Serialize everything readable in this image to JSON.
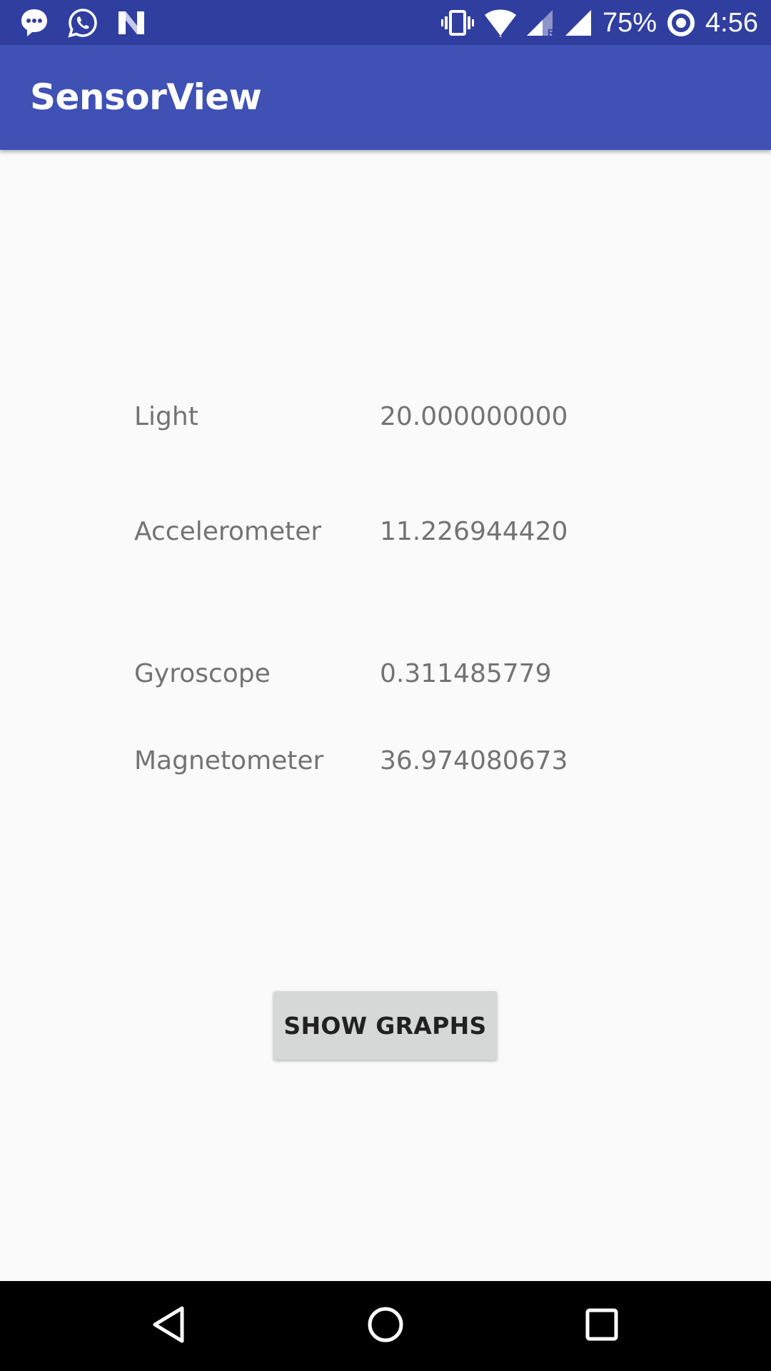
{
  "status_bar": {
    "battery_percent": "75%",
    "time": "4:56",
    "left_icons": [
      "messenger-icon",
      "whatsapp-icon",
      "n-logo-icon"
    ],
    "right_icons": [
      "vibrate-icon",
      "wifi-icon",
      "cell-signal-roaming-icon",
      "cell-signal-icon",
      "battery-saver-icon"
    ],
    "color": "#303f9f"
  },
  "app_bar": {
    "title": "SensorView",
    "color": "#3f51b5"
  },
  "sensors": [
    {
      "label": "Light",
      "value": "20.000000000"
    },
    {
      "label": "Accelerometer",
      "value": "11.226944420"
    },
    {
      "label": "Gyroscope",
      "value": "0.311485779"
    },
    {
      "label": "Magnetometer",
      "value": "36.974080673"
    }
  ],
  "actions": {
    "show_graphs_label": "SHOW GRAPHS"
  },
  "nav_bar": {
    "buttons": [
      "back-icon",
      "home-icon",
      "recents-icon"
    ]
  }
}
